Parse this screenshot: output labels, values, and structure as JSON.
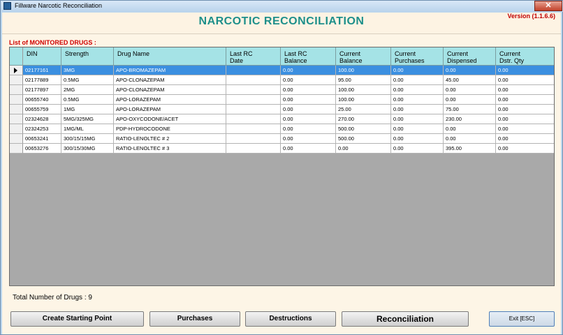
{
  "window": {
    "title": "Fillware Narcotic Reconciliation",
    "close_glyph": "✕"
  },
  "header": {
    "title": "NARCOTIC RECONCILIATION",
    "version": "Version (1.1.6.6)"
  },
  "list_label": "List of MONITORED DRUGS :",
  "columns": [
    "DIN",
    "Strength",
    "Drug Name",
    "Last RC\nDate",
    "Last RC\nBalance",
    "Current\nBalance",
    "Current\nPurchases",
    "Current\nDispensed",
    "Current\nDstr. Qty"
  ],
  "rows": [
    [
      "02177161",
      "3MG",
      "APO-BROMAZEPAM",
      "",
      "0.00",
      "100.00",
      "0.00",
      "0.00",
      "0.00"
    ],
    [
      "02177889",
      "0.5MG",
      "APO-CLONAZEPAM",
      "",
      "0.00",
      "95.00",
      "0.00",
      "45.00",
      "0.00"
    ],
    [
      "02177897",
      "2MG",
      "APO-CLONAZEPAM",
      "",
      "0.00",
      "100.00",
      "0.00",
      "0.00",
      "0.00"
    ],
    [
      "00655740",
      "0.5MG",
      "APO-LORAZEPAM",
      "",
      "0.00",
      "100.00",
      "0.00",
      "0.00",
      "0.00"
    ],
    [
      "00655759",
      "1MG",
      "APO-LORAZEPAM",
      "",
      "0.00",
      "25.00",
      "0.00",
      "75.00",
      "0.00"
    ],
    [
      "02324628",
      "5MG/325MG",
      "APO-OXYCODONE/ACET",
      "",
      "0.00",
      "270.00",
      "0.00",
      "230.00",
      "0.00"
    ],
    [
      "02324253",
      "1MG/ML",
      "PDP-HYDROCODONE",
      "",
      "0.00",
      "500.00",
      "0.00",
      "0.00",
      "0.00"
    ],
    [
      "00653241",
      "300/15/15MG",
      "RATIO-LENOLTEC # 2",
      "",
      "0.00",
      "500.00",
      "0.00",
      "0.00",
      "0.00"
    ],
    [
      "00653276",
      "300/15/30MG",
      "RATIO-LENOLTEC # 3",
      "",
      "0.00",
      "0.00",
      "0.00",
      "395.00",
      "0.00"
    ]
  ],
  "selected_row": 0,
  "total_label": "Total Number of Drugs : 9",
  "buttons": {
    "create": "Create Starting Point",
    "purchases": "Purchases",
    "destructions": "Destructions",
    "reconciliation": "Reconciliation",
    "exit": "Exit [ESC]"
  }
}
